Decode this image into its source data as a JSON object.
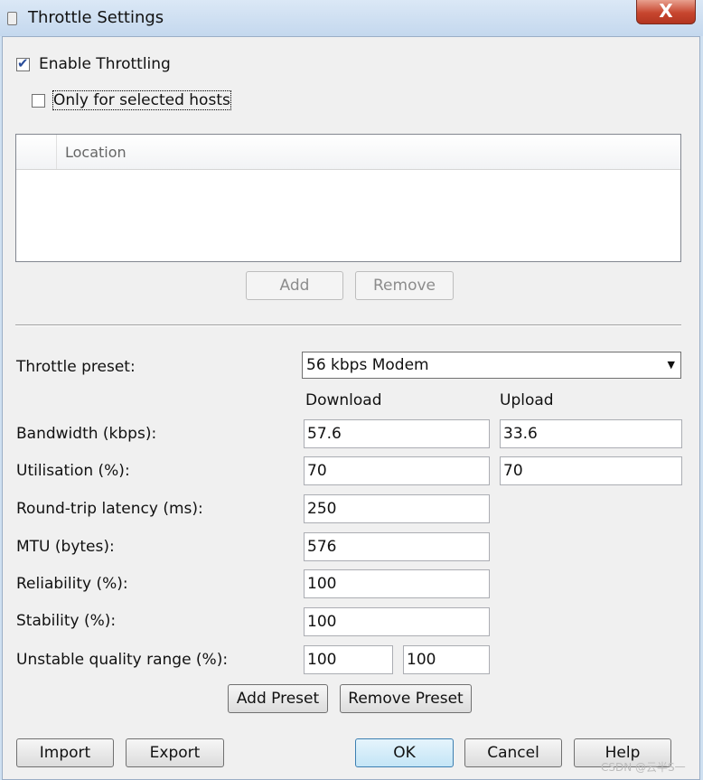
{
  "window": {
    "title": "Throttle Settings",
    "close_label": "X"
  },
  "enable_throttling": {
    "label": "Enable Throttling",
    "checked": true
  },
  "only_selected_hosts": {
    "label": "Only for selected hosts",
    "checked": false
  },
  "hosts_table": {
    "columns": [
      "",
      "Location"
    ],
    "rows": []
  },
  "host_buttons": {
    "add": "Add",
    "remove": "Remove"
  },
  "preset": {
    "label": "Throttle preset:",
    "value": "56 kbps Modem"
  },
  "columns": {
    "download": "Download",
    "upload": "Upload"
  },
  "bandwidth": {
    "label": "Bandwidth (kbps):",
    "download": "57.6",
    "upload": "33.6"
  },
  "utilisation": {
    "label": "Utilisation (%):",
    "download": "70",
    "upload": "70"
  },
  "latency": {
    "label": "Round-trip latency (ms):",
    "value": "250"
  },
  "mtu": {
    "label": "MTU (bytes):",
    "value": "576"
  },
  "reliability": {
    "label": "Reliability (%):",
    "value": "100"
  },
  "stability": {
    "label": "Stability (%):",
    "value": "100"
  },
  "unstable_range": {
    "label": "Unstable quality range (%):",
    "min": "100",
    "max": "100"
  },
  "preset_buttons": {
    "add": "Add Preset",
    "remove": "Remove Preset"
  },
  "footer": {
    "import": "Import",
    "export": "Export",
    "ok": "OK",
    "cancel": "Cancel",
    "help": "Help"
  },
  "watermark": "CSDN @云半S一"
}
